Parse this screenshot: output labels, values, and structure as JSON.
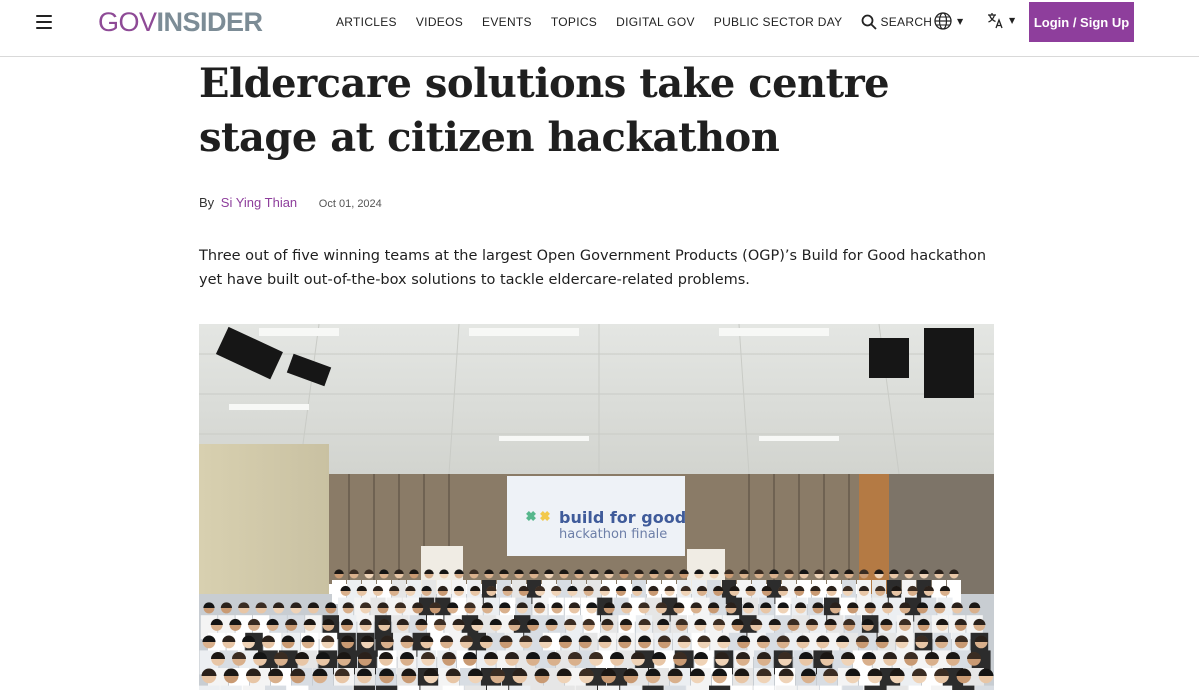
{
  "header": {
    "logo_part1": "GOV",
    "logo_part2": "INSIDER",
    "nav": [
      "ARTICLES",
      "VIDEOS",
      "EVENTS",
      "TOPICS",
      "DIGITAL GOV",
      "PUBLIC SECTOR DAY"
    ],
    "search_label": "SEARCH",
    "login_label": "Login / Sign Up",
    "icons": [
      "menu-icon",
      "search-icon",
      "globe-icon",
      "translate-icon"
    ],
    "colors": {
      "brand_purple": "#8e3e9c",
      "logo_gray": "#7c8c96"
    }
  },
  "article": {
    "title": "Eldercare solutions take centre stage at citizen hackathon",
    "by_label": "By",
    "author": "Si Ying Thian",
    "date": "Oct 01, 2024",
    "lede": "Three out of five winning teams at the largest Open Government Products (OGP)’s Build for Good hackathon yet have built out-of-the-box solutions to tackle eldercare-related problems.",
    "photo": {
      "screen_line1": "build for good",
      "screen_line2": "hackathon finale"
    }
  }
}
